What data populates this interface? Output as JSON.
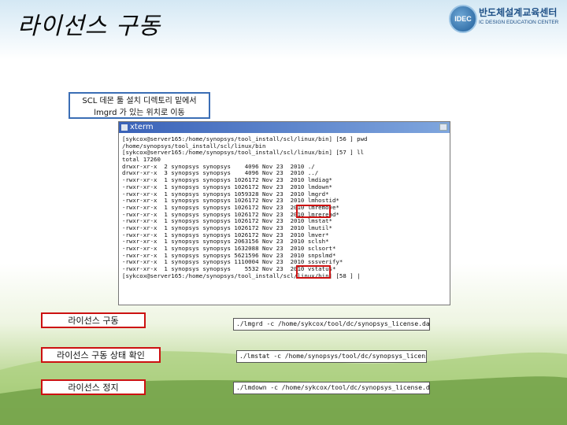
{
  "slide": {
    "title": "라이선스 구동",
    "logo": {
      "mark": "IDEC",
      "name": "반도체설계교육센터",
      "sub": "IC DESIGN EDUCATION CENTER"
    }
  },
  "note": {
    "line1": "SCL 데몬 툴 설치 디렉토리 밑에서",
    "line2": "lmgrd 가 있는 위치로 이동"
  },
  "xterm": {
    "title": "xterm",
    "lines": [
      "[sykcox@server165:/home/synopsys/tool_install/scl/linux/bin] [56 ] pwd",
      "/home/synopsys/tool_install/scl/linux/bin",
      "[sykcox@server165:/home/synopsys/tool_install/scl/linux/bin] [57 ] ll",
      "total 17260",
      "drwxr-xr-x  2 synopsys synopsys    4096 Nov 23  2010 ./",
      "drwxr-xr-x  3 synopsys synopsys    4096 Nov 23  2010 ../",
      "-rwxr-xr-x  1 synopsys synopsys 1026172 Nov 23  2010 lmdiag*",
      "-rwxr-xr-x  1 synopsys synopsys 1026172 Nov 23  2010 lmdown*",
      "-rwxr-xr-x  1 synopsys synopsys 1059328 Nov 23  2010 lmgrd*",
      "-rwxr-xr-x  1 synopsys synopsys 1026172 Nov 23  2010 lmhostid*",
      "-rwxr-xr-x  1 synopsys synopsys 1026172 Nov 23  2010 lmremove*",
      "-rwxr-xr-x  1 synopsys synopsys 1026172 Nov 23  2010 lmreread*",
      "-rwxr-xr-x  1 synopsys synopsys 1026172 Nov 23  2010 lmstat*",
      "-rwxr-xr-x  1 synopsys synopsys 1026172 Nov 23  2010 lmutil*",
      "-rwxr-xr-x  1 synopsys synopsys 1026172 Nov 23  2010 lmver*",
      "-rwxr-xr-x  1 synopsys synopsys 2063156 Nov 23  2010 sclsh*",
      "-rwxr-xr-x  1 synopsys synopsys 1632088 Nov 23  2010 sclsort*",
      "-rwxr-xr-x  1 synopsys synopsys 5621596 Nov 23  2010 snpslmd*",
      "-rwxr-xr-x  1 synopsys synopsys 1110004 Nov 23  2010 sssverify*",
      "-rwxr-xr-x  1 synopsys synopsys    5532 Nov 23  2010 vstatus*",
      "[sykcox@server165:/home/synopsys/tool_install/scl/linux/bin] [58 ] |"
    ]
  },
  "actions": [
    {
      "label": "라이선스 구동",
      "command": "./lmgrd -c /home/sykcox/tool/dc/synopsys_license.dat"
    },
    {
      "label": "라이선스 구동 상태 확인",
      "command": "./lmstat -c /home/synopsys/tool/dc/synopsys_license.dat"
    },
    {
      "label": "라이선스 정지",
      "command": "./lmdown -c /home/sykcox/tool/dc/synopsys_license.dat"
    }
  ],
  "colors": {
    "highlight": "#cc1111",
    "note_border": "#3b6eb5",
    "titlebar": "#3a62b8"
  }
}
